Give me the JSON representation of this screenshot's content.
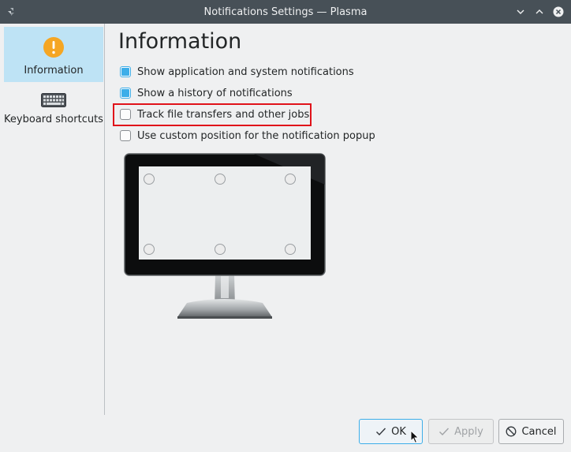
{
  "window": {
    "title": "Notifications Settings — Plasma"
  },
  "sidebar": {
    "items": [
      {
        "label": "Information",
        "icon": "information-icon",
        "selected": true
      },
      {
        "label": "Keyboard shortcuts",
        "icon": "keyboard-icon",
        "selected": false
      }
    ]
  },
  "main": {
    "title": "Information",
    "options": [
      {
        "label": "Show application and system notifications",
        "checked": true
      },
      {
        "label": "Show a history of notifications",
        "checked": true
      },
      {
        "label": "Track file transfers and other jobs",
        "checked": false,
        "highlighted": true
      },
      {
        "label": "Use custom position for the notification popup",
        "checked": false
      }
    ]
  },
  "buttons": {
    "ok": "OK",
    "apply": "Apply",
    "cancel": "Cancel"
  },
  "colors": {
    "accent": "#3daee9",
    "highlight": "#e0121a",
    "titlebar": "#475057",
    "selection": "#bee3f5"
  }
}
